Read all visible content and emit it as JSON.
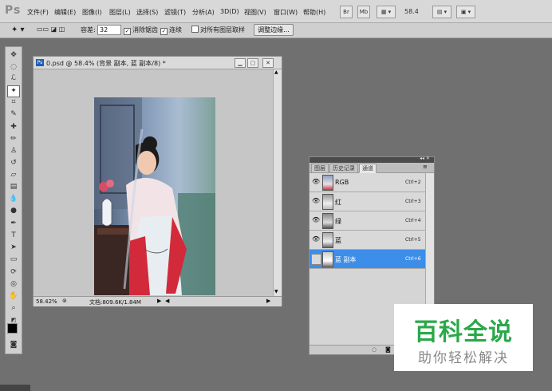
{
  "app": {
    "logo": "Ps"
  },
  "menu": [
    "文件(F)",
    "编辑(E)",
    "图像(I)",
    "图层(L)",
    "选择(S)",
    "滤镜(T)",
    "分析(A)",
    "3D(D)",
    "视图(V)",
    "窗口(W)",
    "帮助(H)"
  ],
  "menubar_right": {
    "bridge": "Br",
    "minibridge": "Mb",
    "zoom": "58.4"
  },
  "options": {
    "tolerance_label": "容差:",
    "tolerance_value": "32",
    "antialias_label": "消除锯齿",
    "contiguous_label": "连续",
    "sample_all_label": "对所有图层取样",
    "refine_edge_label": "调整边缘..."
  },
  "document": {
    "title": "0.psd @ 58.4% (背景 副本, 蓝 副本/8) *",
    "zoom": "58.42%",
    "doc_size": "文档:809.6K/1.84M"
  },
  "panel": {
    "tabs": [
      "图层",
      "历史记录",
      "通道"
    ],
    "active_tab": "通道",
    "channels": [
      {
        "name": "RGB",
        "shortcut": "Ctrl+2",
        "visible": true
      },
      {
        "name": "红",
        "shortcut": "Ctrl+3",
        "visible": true
      },
      {
        "name": "绿",
        "shortcut": "Ctrl+4",
        "visible": true
      },
      {
        "name": "蓝",
        "shortcut": "Ctrl+5",
        "visible": true
      },
      {
        "name": "蓝 副本",
        "shortcut": "Ctrl+6",
        "visible": false,
        "selected": true
      }
    ]
  },
  "watermark": {
    "title": "百科全说",
    "subtitle": "助你轻松解决"
  },
  "colors": {
    "selected_row": "#3d8ee8",
    "workspace": "#707070",
    "watermark_green": "#2ba84a"
  }
}
